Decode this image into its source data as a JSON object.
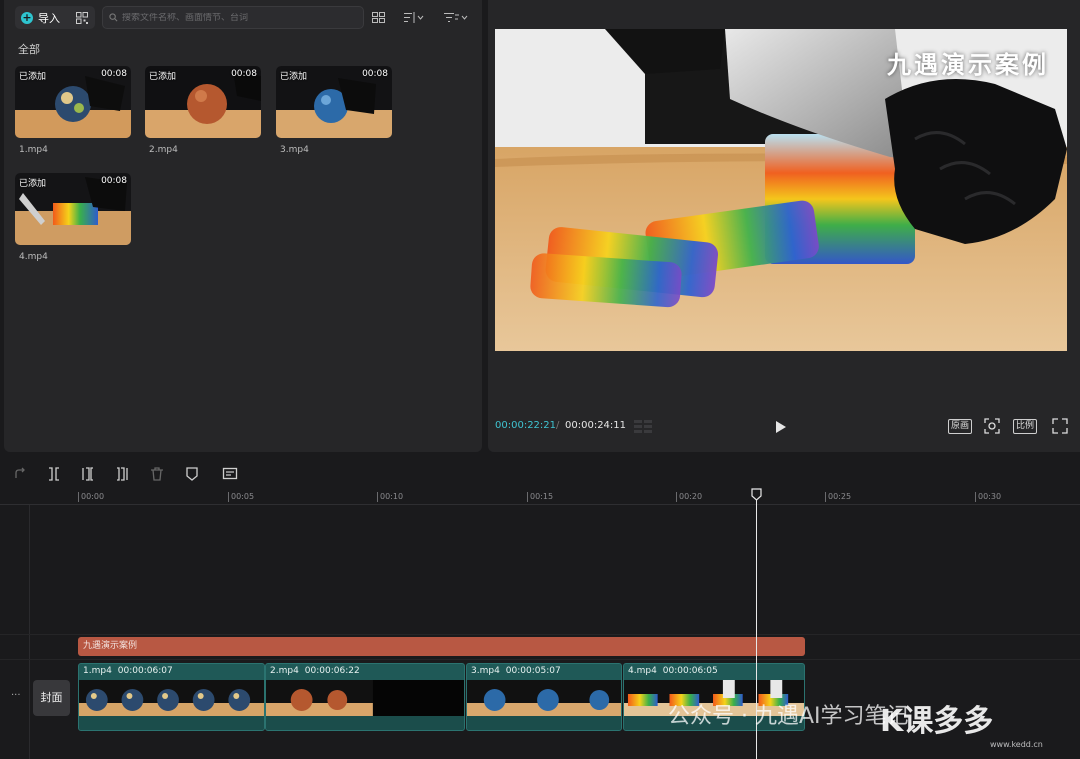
{
  "media": {
    "import_label": "导入",
    "search_placeholder": "搜索文件名称、画面情节、台词",
    "filter_all": "全部",
    "items": [
      {
        "badge": "已添加",
        "duration": "00:08",
        "name": "1.mp4"
      },
      {
        "badge": "已添加",
        "duration": "00:08",
        "name": "2.mp4"
      },
      {
        "badge": "已添加",
        "duration": "00:08",
        "name": "3.mp4"
      },
      {
        "badge": "已添加",
        "duration": "00:08",
        "name": "4.mp4"
      }
    ]
  },
  "player": {
    "overlay_title": "九遇演示案例",
    "current_time": "00:00:22:21",
    "separator": "/",
    "total_time": "00:00:24:11",
    "original_label": "原画",
    "ratio_label": "比例"
  },
  "timeline": {
    "ruler_labels": [
      "00:00",
      "00:05",
      "00:10",
      "00:15",
      "00:20",
      "00:25",
      "00:30"
    ],
    "text_clip": "九遇演示案例",
    "cover_label": "封面",
    "more": "···",
    "clips": [
      {
        "name": "1.mp4",
        "duration": "00:00:06:07"
      },
      {
        "name": "2.mp4",
        "duration": "00:00:06:22"
      },
      {
        "name": "3.mp4",
        "duration": "00:00:05:07"
      },
      {
        "name": "4.mp4",
        "duration": "00:00:06:05"
      }
    ]
  },
  "watermark": {
    "text": "公众号 · 九遇AI学习笔记",
    "logo": "K课多多",
    "site": "www.kedd.cn"
  }
}
